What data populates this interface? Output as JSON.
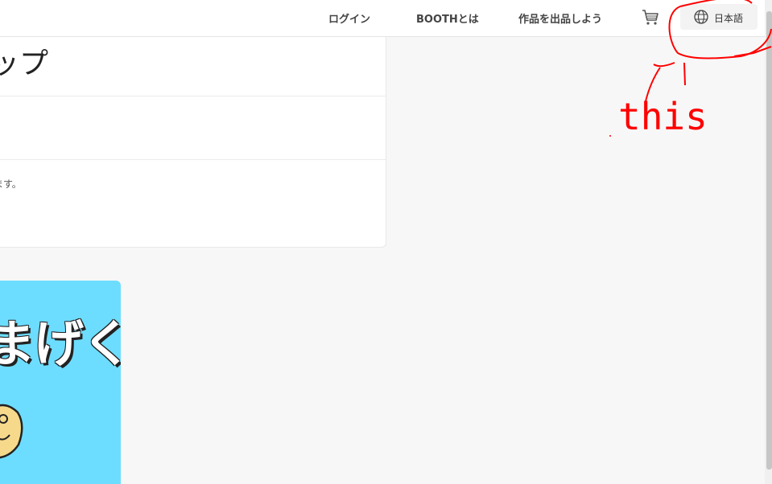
{
  "header": {
    "nav": {
      "login": "ログイン",
      "about": "BOOTHとは",
      "sell": "作品を出品しよう"
    },
    "cart_icon": "cart-icon",
    "language": {
      "icon": "globe-icon",
      "label": "日本語"
    }
  },
  "card": {
    "title": "ップ",
    "description": "ます。"
  },
  "image_tile": {
    "text": "まげくん"
  },
  "annotation": {
    "text": "this",
    "color": "#ff0000"
  },
  "colors": {
    "header_bg": "#ffffff",
    "page_bg": "#f7f7f7",
    "tile_bg": "#6dddff",
    "annotation": "#ff0000"
  }
}
